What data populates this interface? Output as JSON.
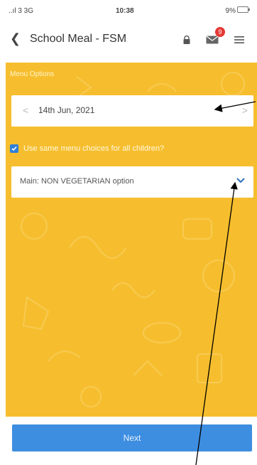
{
  "status_bar": {
    "signal": "..ıl 3 3G",
    "time": "10:38",
    "battery": "9%"
  },
  "nav": {
    "back_icon": "chevron-left-icon",
    "title": "School Meal - FSM",
    "icons": [
      "lock-icon",
      "mail-icon",
      "menu-icon"
    ],
    "mail_badge": "9"
  },
  "menu": {
    "section_label": "Menu Options",
    "date": {
      "prev_symbol": "<",
      "value": "14th Jun, 2021",
      "next_symbol": ">"
    },
    "same_choices": {
      "checked": true,
      "label": "Use same menu choices for all children?"
    },
    "main_select": {
      "value": "Main: NON VEGETARIAN option"
    }
  },
  "footer": {
    "next_label": "Next"
  },
  "colors": {
    "background": "#f6be2e",
    "button": "#3d8ee0",
    "checkbox": "#2f7fd6",
    "badge": "#e53935"
  }
}
